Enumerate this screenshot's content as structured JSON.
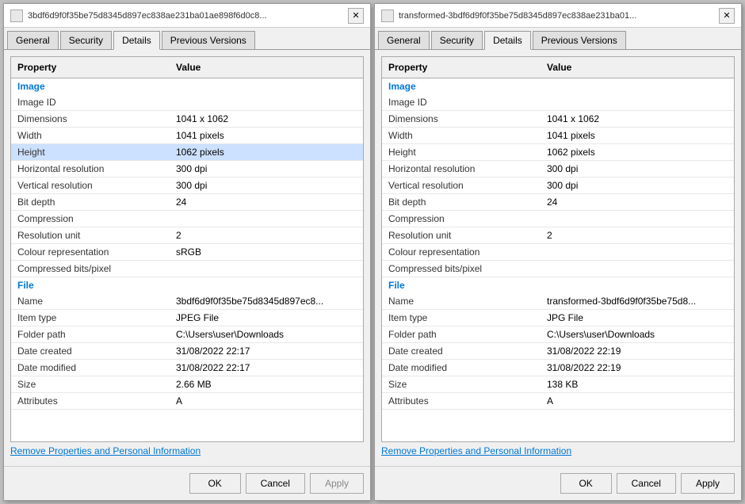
{
  "dialog1": {
    "title": "3bdf6d9f0f35be75d8345d897ec838ae231ba01ae898f6d0c8...",
    "tabs": [
      "General",
      "Security",
      "Details",
      "Previous Versions"
    ],
    "active_tab": "Details",
    "table": {
      "col1": "Property",
      "col2": "Value",
      "sections": [
        {
          "name": "Image",
          "rows": [
            {
              "property": "Image ID",
              "value": ""
            },
            {
              "property": "Dimensions",
              "value": "1041 x 1062"
            },
            {
              "property": "Width",
              "value": "1041 pixels"
            },
            {
              "property": "Height",
              "value": "1062 pixels",
              "highlighted": true
            },
            {
              "property": "Horizontal resolution",
              "value": "300 dpi"
            },
            {
              "property": "Vertical resolution",
              "value": "300 dpi"
            },
            {
              "property": "Bit depth",
              "value": "24"
            },
            {
              "property": "Compression",
              "value": ""
            },
            {
              "property": "Resolution unit",
              "value": "2"
            },
            {
              "property": "Colour representation",
              "value": "sRGB"
            },
            {
              "property": "Compressed bits/pixel",
              "value": ""
            }
          ]
        },
        {
          "name": "File",
          "rows": [
            {
              "property": "Name",
              "value": "3bdf6d9f0f35be75d8345d897ec8..."
            },
            {
              "property": "Item type",
              "value": "JPEG File"
            },
            {
              "property": "Folder path",
              "value": "C:\\Users\\user\\Downloads"
            },
            {
              "property": "Date created",
              "value": "31/08/2022 22:17"
            },
            {
              "property": "Date modified",
              "value": "31/08/2022 22:17"
            },
            {
              "property": "Size",
              "value": "2.66 MB"
            },
            {
              "property": "Attributes",
              "value": "A"
            }
          ]
        }
      ]
    },
    "remove_link": "Remove Properties and Personal Information",
    "buttons": {
      "ok": "OK",
      "cancel": "Cancel",
      "apply": "Apply"
    }
  },
  "dialog2": {
    "title": "transformed-3bdf6d9f0f35be75d8345d897ec838ae231ba01...",
    "tabs": [
      "General",
      "Security",
      "Details",
      "Previous Versions"
    ],
    "active_tab": "Details",
    "table": {
      "col1": "Property",
      "col2": "Value",
      "sections": [
        {
          "name": "Image",
          "rows": [
            {
              "property": "Image ID",
              "value": ""
            },
            {
              "property": "Dimensions",
              "value": "1041 x 1062"
            },
            {
              "property": "Width",
              "value": "1041 pixels"
            },
            {
              "property": "Height",
              "value": "1062 pixels"
            },
            {
              "property": "Horizontal resolution",
              "value": "300 dpi"
            },
            {
              "property": "Vertical resolution",
              "value": "300 dpi"
            },
            {
              "property": "Bit depth",
              "value": "24"
            },
            {
              "property": "Compression",
              "value": ""
            },
            {
              "property": "Resolution unit",
              "value": "2"
            },
            {
              "property": "Colour representation",
              "value": ""
            },
            {
              "property": "Compressed bits/pixel",
              "value": ""
            }
          ]
        },
        {
          "name": "File",
          "rows": [
            {
              "property": "Name",
              "value": "transformed-3bdf6d9f0f35be75d8..."
            },
            {
              "property": "Item type",
              "value": "JPG File"
            },
            {
              "property": "Folder path",
              "value": "C:\\Users\\user\\Downloads"
            },
            {
              "property": "Date created",
              "value": "31/08/2022 22:19"
            },
            {
              "property": "Date modified",
              "value": "31/08/2022 22:19"
            },
            {
              "property": "Size",
              "value": "138 KB"
            },
            {
              "property": "Attributes",
              "value": "A"
            }
          ]
        }
      ]
    },
    "remove_link": "Remove Properties and Personal Information",
    "buttons": {
      "ok": "OK",
      "cancel": "Cancel",
      "apply": "Apply"
    }
  }
}
